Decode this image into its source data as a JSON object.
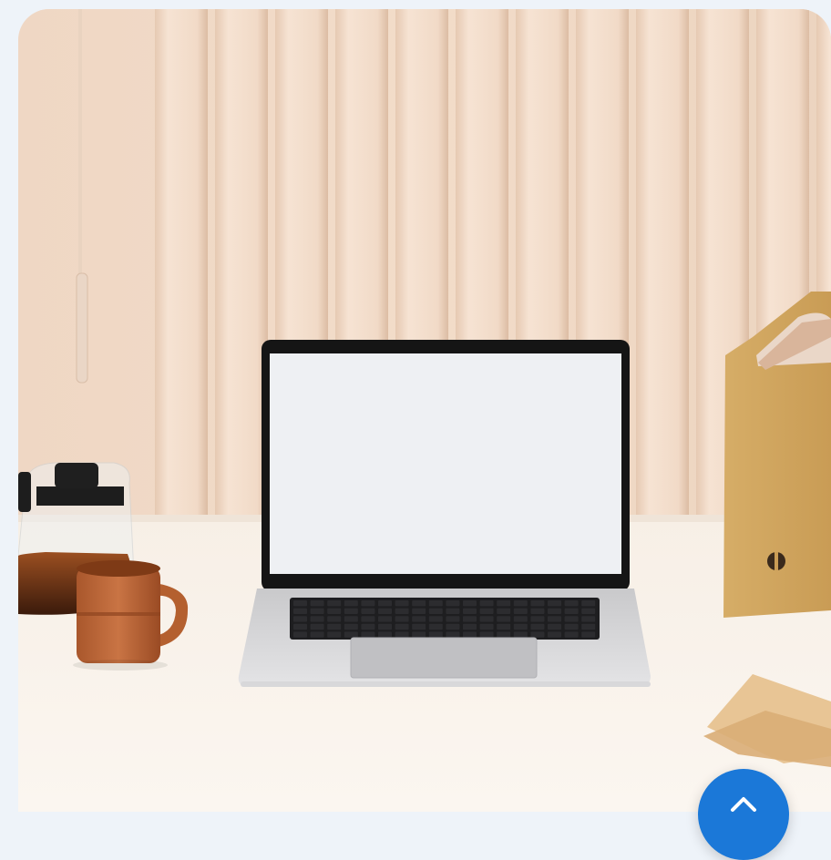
{
  "hero_image": {
    "alt": "",
    "accent": "#1b78d8"
  },
  "scroll_top_button": {
    "icon": "chevron-up-icon"
  }
}
